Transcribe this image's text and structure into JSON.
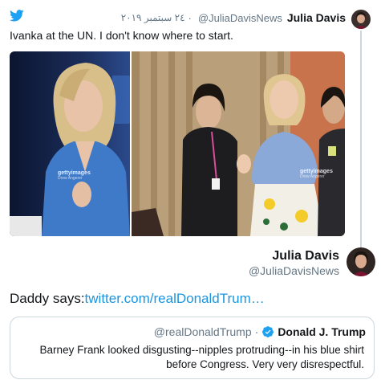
{
  "parent_tweet": {
    "author_name": "Julia Davis",
    "author_handle": "@JuliaDavisNews",
    "date": "٢٤ سبتمبر ٢٠١٩",
    "text": "Ivanka at the UN. I don't know where to start.",
    "media": [
      {
        "watermark": "gettyimages",
        "credit": "Drew Angerer"
      },
      {
        "watermark": "gettyimages",
        "credit": "Drew Angerer"
      }
    ]
  },
  "reply_tweet": {
    "author_name": "Julia Davis",
    "author_handle": "@JuliaDavisNews",
    "text_prefix": "Daddy says:",
    "link_text": "twitter.com/realDonaldTrum…"
  },
  "quoted_tweet": {
    "author_name": "Donald J. Trump",
    "author_handle": "@realDonaldTrump",
    "text": "Barney Frank looked disgusting--nipples protruding--in his blue shirt before Congress. Very very disrespectful."
  },
  "icons": {
    "brand": "twitter-bird-icon",
    "verified": "verified-badge-icon"
  },
  "colors": {
    "link": "#1b95e0",
    "secondary_text": "#657786",
    "border": "#ccd6dd",
    "twitter_blue": "#1da1f2"
  }
}
